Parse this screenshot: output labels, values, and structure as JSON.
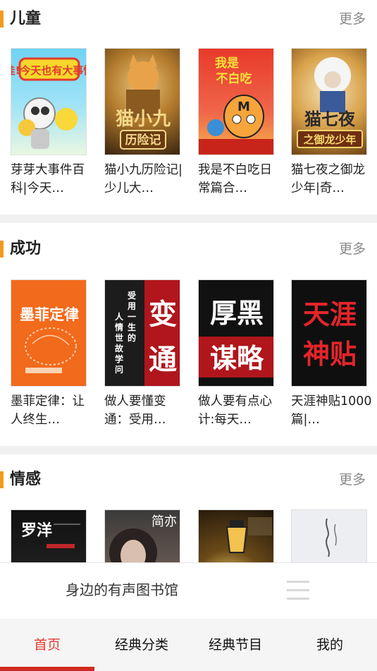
{
  "sections": [
    {
      "title": "儿童",
      "more": "更多",
      "cards": [
        {
          "title": "芽芽大事件百科|今天…",
          "cover_text": "哇!今天也有大事情"
        },
        {
          "title": "猫小九历险记|少儿大…",
          "cover_text": "猫小九历险记"
        },
        {
          "title": "我是不白吃日常篇合…",
          "cover_text": "我是不白吃"
        },
        {
          "title": "猫七夜之御龙少年|奇…",
          "cover_text": "猫七夜之御龙少年"
        }
      ]
    },
    {
      "title": "成功",
      "more": "更多",
      "cards": [
        {
          "title": "墨菲定律：让人终生…",
          "cover_text": "墨菲定律"
        },
        {
          "title": "做人要懂变通：受用…",
          "cover_text": "变通",
          "cover_side": "受用一生的人情世故学问"
        },
        {
          "title": "做人要有点心计:每天…",
          "cover_text_top": "厚黑",
          "cover_text_bottom": "谋略"
        },
        {
          "title": "天涯神贴1000篇|…",
          "cover_text": "天涯神贴"
        }
      ]
    },
    {
      "title": "情感",
      "more": "更多",
      "cards": [
        {
          "title": "",
          "cover_text": "罗洋"
        },
        {
          "title": "",
          "cover_text": "简亦"
        },
        {
          "title": "",
          "cover_text": ""
        },
        {
          "title": "",
          "cover_text": ""
        }
      ]
    }
  ],
  "bottom_bar": {
    "title": "身边的有声图书馆"
  },
  "tabs": [
    {
      "label": "首页",
      "active": true
    },
    {
      "label": "经典分类",
      "active": false
    },
    {
      "label": "经典节目",
      "active": false
    },
    {
      "label": "我的",
      "active": false
    }
  ],
  "colors": {
    "accent_bar": "#f39a1e",
    "active_tab": "#e23b2f",
    "indicator": "#d12b1f"
  }
}
